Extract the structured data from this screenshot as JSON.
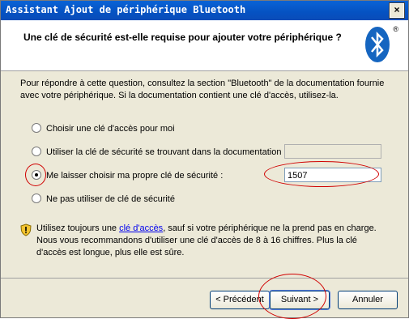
{
  "titlebar": {
    "title": "Assistant Ajout de périphérique Bluetooth",
    "close_glyph": "×"
  },
  "header": {
    "title": "Une clé de sécurité est-elle requise pour ajouter votre périphérique ?",
    "logo_icon": "bluetooth-icon",
    "registered": "®"
  },
  "intro": "Pour répondre à cette question, consultez la section \"Bluetooth\" de la documentation fournie avec votre périphérique. Si la documentation contient une clé d'accès, utilisez-la.",
  "options": [
    {
      "label": "Choisir une clé d'accès pour moi",
      "selected": false
    },
    {
      "label": "Utiliser la clé de sécurité se trouvant dans la documentation :",
      "selected": false
    },
    {
      "label": "Me laisser choisir ma propre clé de sécurité :",
      "selected": true
    },
    {
      "label": "Ne pas utiliser de clé de sécurité",
      "selected": false
    }
  ],
  "fields": {
    "doc_key": "",
    "own_key": "1507"
  },
  "tip": {
    "icon": "shield-warning-icon",
    "before_link": "Utilisez toujours une ",
    "link": "clé d'accès",
    "after_link": ", sauf si votre périphérique ne la prend pas en charge. Nous vous recommandons d'utiliser une clé d'accès de 8 à 16 chiffres. Plus la clé d'accès est longue, plus elle est sûre."
  },
  "buttons": {
    "back": "< Précédent",
    "next": "Suivant >",
    "cancel": "Annuler"
  },
  "colors": {
    "titlebar": "#0552c2",
    "dialog": "#ece9d8",
    "annotation": "#d00000",
    "bluetooth": "#1565c0"
  }
}
